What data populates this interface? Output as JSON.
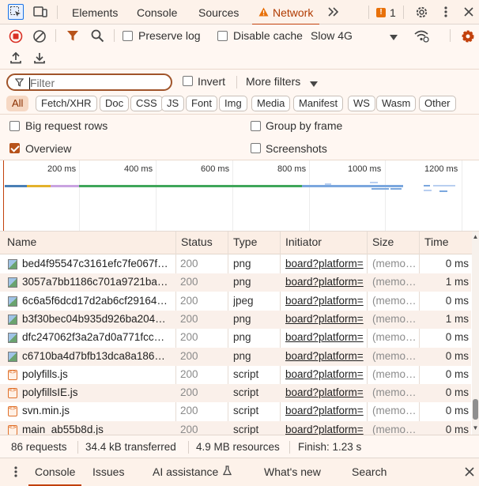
{
  "tabbar": {
    "tabs": [
      "Elements",
      "Console",
      "Sources",
      "Network"
    ],
    "active_tab": "Network",
    "issues_count": "1"
  },
  "toolbar": {
    "preserve_log": "Preserve log",
    "disable_cache": "Disable cache",
    "throttle": "Slow 4G"
  },
  "filter": {
    "placeholder": "Filter",
    "invert": "Invert",
    "more_filters": "More filters"
  },
  "type_filters": [
    "All",
    "Fetch/XHR",
    "Doc",
    "CSS",
    "JS",
    "Font",
    "Img",
    "Media",
    "Manifest",
    "WS",
    "Wasm",
    "Other"
  ],
  "options": {
    "big_rows": "Big request rows",
    "group_by_frame": "Group by frame",
    "overview": "Overview",
    "screenshots": "Screenshots"
  },
  "overview": {
    "ticks": [
      "200 ms",
      "400 ms",
      "600 ms",
      "800 ms",
      "1000 ms",
      "1200 ms"
    ]
  },
  "table": {
    "headers": [
      "Name",
      "Status",
      "Type",
      "Initiator",
      "Size",
      "Time"
    ],
    "rows": [
      {
        "name": "bed4f95547c3161efc7fe067f…",
        "status": "200",
        "type": "png",
        "initiator": "board?platform=",
        "size": "(memo…",
        "time": "0 ms",
        "icon": "image-file-icon"
      },
      {
        "name": "3057a7bb1186c701a9721ba…",
        "status": "200",
        "type": "png",
        "initiator": "board?platform=",
        "size": "(memo…",
        "time": "1 ms",
        "icon": "image-file-icon"
      },
      {
        "name": "6c6a5f6dcd17d2ab6cf29164…",
        "status": "200",
        "type": "jpeg",
        "initiator": "board?platform=",
        "size": "(memo…",
        "time": "0 ms",
        "icon": "image-file-icon"
      },
      {
        "name": "b3f30bec04b935d926ba204…",
        "status": "200",
        "type": "png",
        "initiator": "board?platform=",
        "size": "(memo…",
        "time": "1 ms",
        "icon": "image-file-icon"
      },
      {
        "name": "dfc247062f3a2a7d0a771fcc…",
        "status": "200",
        "type": "png",
        "initiator": "board?platform=",
        "size": "(memo…",
        "time": "0 ms",
        "icon": "image-file-icon"
      },
      {
        "name": "c6710ba4d7bfb13dca8a186…",
        "status": "200",
        "type": "png",
        "initiator": "board?platform=",
        "size": "(memo…",
        "time": "0 ms",
        "icon": "image-file-icon"
      },
      {
        "name": "polyfills.js",
        "status": "200",
        "type": "script",
        "initiator": "board?platform=",
        "size": "(memo…",
        "time": "0 ms",
        "icon": "script-file-icon"
      },
      {
        "name": "polyfillsIE.js",
        "status": "200",
        "type": "script",
        "initiator": "board?platform=",
        "size": "(memo…",
        "time": "0 ms",
        "icon": "script-file-icon"
      },
      {
        "name": "svn.min.js",
        "status": "200",
        "type": "script",
        "initiator": "board?platform=",
        "size": "(memo…",
        "time": "0 ms",
        "icon": "script-file-icon"
      },
      {
        "name": "main_ab55b8d.js",
        "status": "200",
        "type": "script",
        "initiator": "board?platform=",
        "size": "(memo…",
        "time": "0 ms",
        "icon": "script-file-icon"
      }
    ]
  },
  "summary": {
    "requests": "86 requests",
    "transferred": "34.4 kB transferred",
    "resources": "4.9 MB resources",
    "finish": "Finish: 1.23 s"
  },
  "drawer": {
    "tabs": [
      "Console",
      "Issues",
      "AI assistance",
      "What's new",
      "Search"
    ],
    "active_tab": "Console"
  },
  "colors": {
    "accent": "#c2410c",
    "record_red": "#d93025",
    "toolbar_bg": "#fff7f2"
  }
}
